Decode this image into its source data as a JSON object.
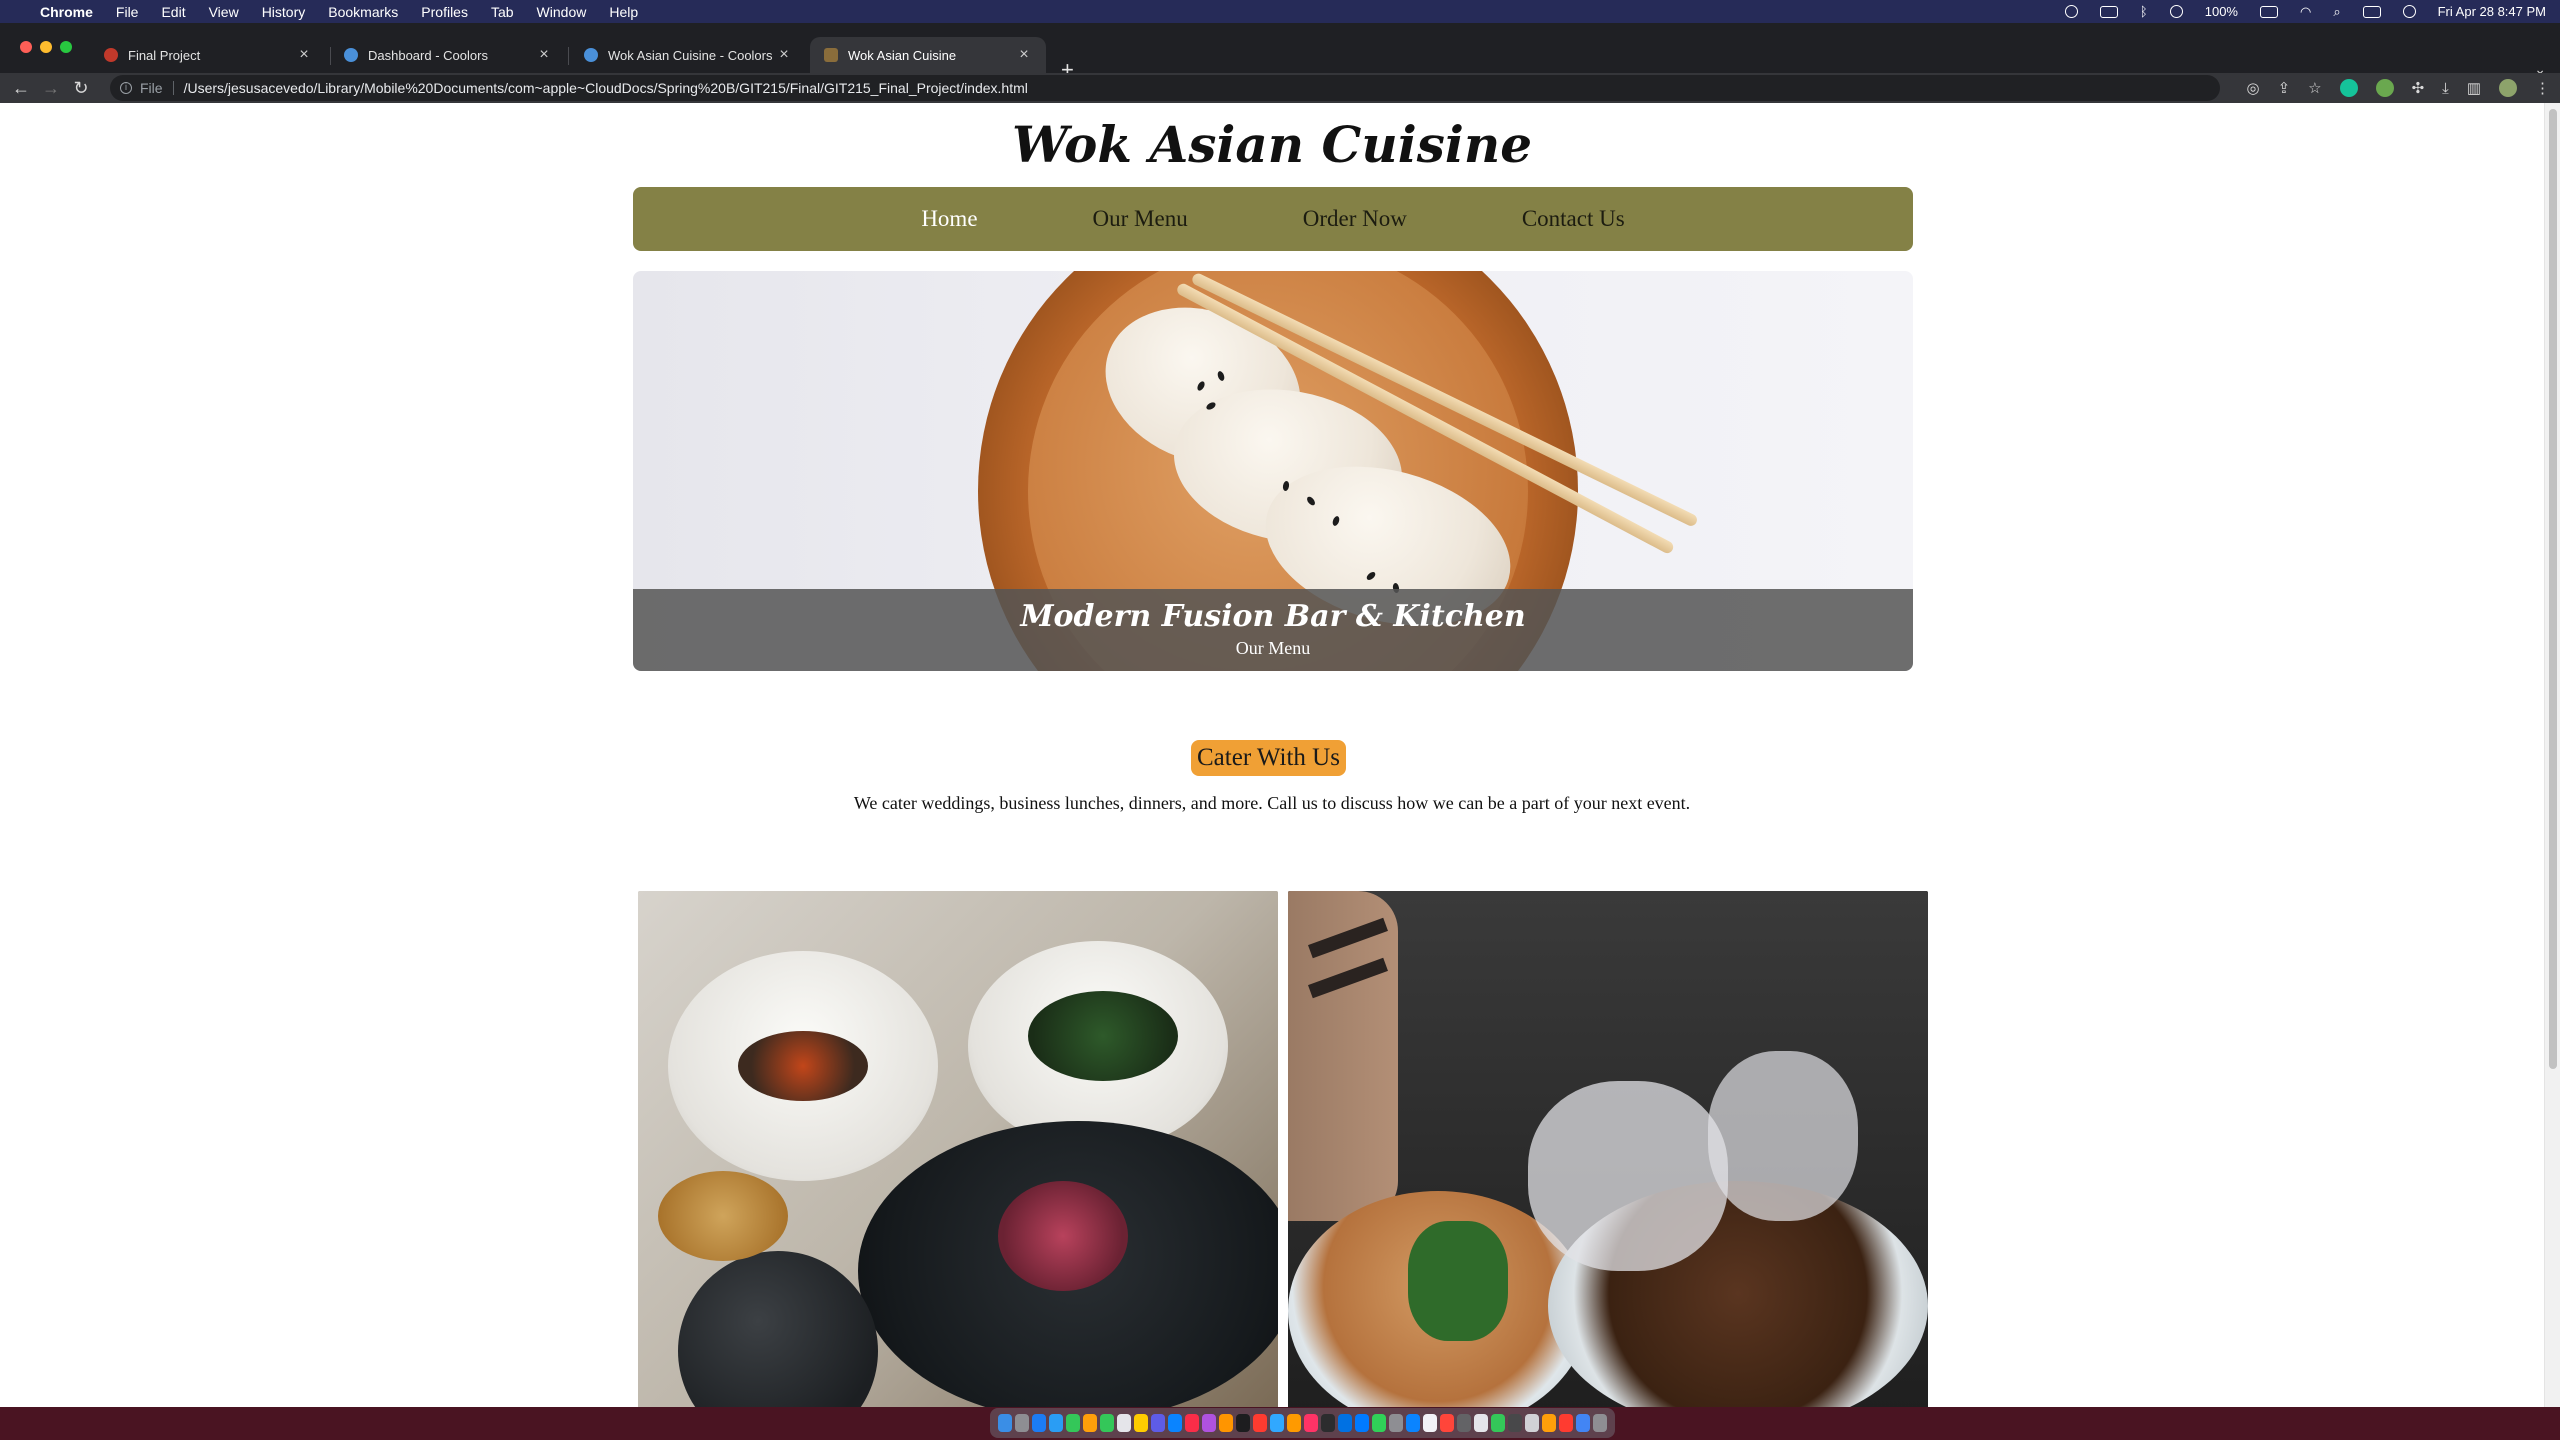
{
  "menubar": {
    "app": "Chrome",
    "items": [
      "File",
      "Edit",
      "View",
      "History",
      "Bookmarks",
      "Profiles",
      "Tab",
      "Window",
      "Help"
    ],
    "battery": "100%",
    "datetime": "Fri Apr 28  8:47 PM"
  },
  "tabs": [
    {
      "title": "Final Project",
      "favicon_color": "#c0392b"
    },
    {
      "title": "Dashboard - Coolors",
      "favicon_color": "#4a90d9"
    },
    {
      "title": "Wok Asian Cuisine - Coolors",
      "favicon_color": "#4a90d9"
    },
    {
      "title": "Wok Asian Cuisine",
      "favicon_color": "#8a6d3b",
      "active": true
    }
  ],
  "toolbar": {
    "scheme_chip": "File",
    "url": "/Users/jesusacevedo/Library/Mobile%20Documents/com~apple~CloudDocs/Spring%20B/GIT215/Final/GIT215_Final_Project/index.html"
  },
  "site": {
    "title": "Wok Asian Cuisine",
    "nav": [
      "Home",
      "Our Menu",
      "Order Now",
      "Contact Us"
    ],
    "nav_active": "Home",
    "hero": {
      "title": "Modern Fusion Bar & Kitchen",
      "subtitle": "Our Menu"
    },
    "cater": {
      "heading": "Cater With Us",
      "text": "We cater weddings, business lunches, dinners, and more. Call us to discuss how we can be a part of your next event."
    }
  },
  "colors": {
    "nav_bg": "#848146",
    "cater_badge": "#f0a035",
    "caption_bg": "#555555"
  }
}
